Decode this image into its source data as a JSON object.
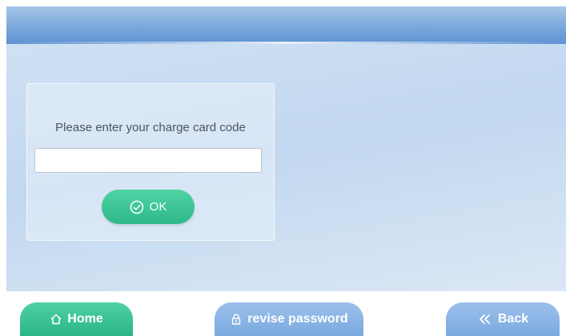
{
  "card": {
    "prompt": "Please enter your charge card code",
    "input_value": "",
    "input_placeholder": "",
    "ok_label": "OK",
    "ok_icon": "check-circle-icon"
  },
  "footer": {
    "home_label": "Home",
    "home_icon": "home-icon",
    "revise_label": "revise password",
    "revise_icon": "lock-icon",
    "back_label": "Back",
    "back_icon": "double-chevron-left-icon"
  },
  "colors": {
    "header": "#7aa8dc",
    "green_button": "#2fb88a",
    "blue_button": "#7aa9e0",
    "panel_text": "#4b5563"
  }
}
